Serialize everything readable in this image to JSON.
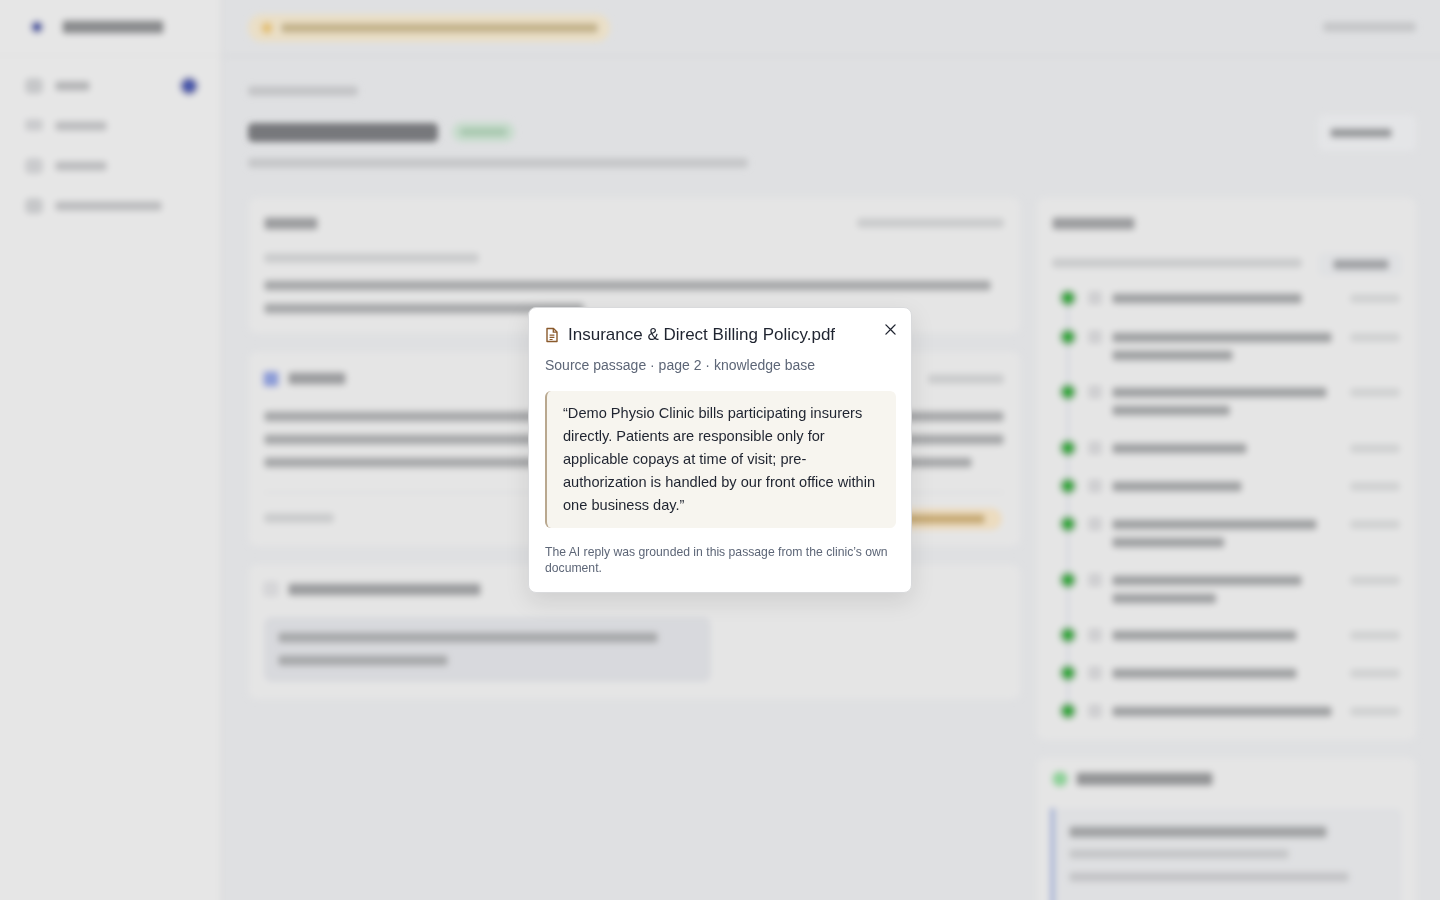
{
  "modal": {
    "title": "Insurance & Direct Billing Policy.pdf",
    "subtitle": "Source passage · page 2 · knowledge base",
    "quote": "“Demo Physio Clinic bills participating insurers directly. Patients are responsible only for applicable copays at time of visit; pre-authorization is handled by our front office within one business day.”",
    "note": "The AI reply was grounded in this passage from the clinic’s own document."
  }
}
